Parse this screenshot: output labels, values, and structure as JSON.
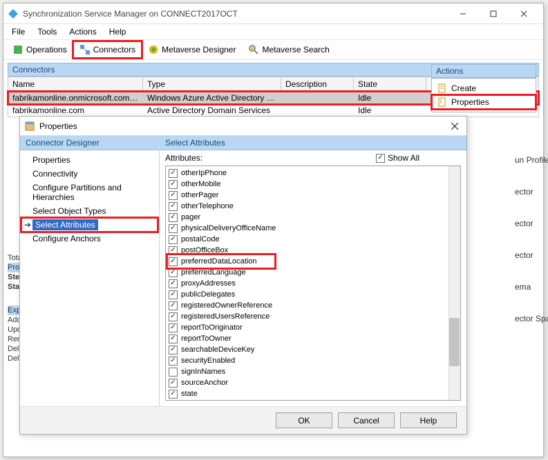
{
  "title": "Synchronization Service Manager on CONNECT2017OCT",
  "menu": [
    "File",
    "Tools",
    "Actions",
    "Help"
  ],
  "toolbar": [
    {
      "label": "Operations",
      "name": "operations-button"
    },
    {
      "label": "Connectors",
      "name": "connectors-button"
    },
    {
      "label": "Metaverse Designer",
      "name": "metaverse-designer-button"
    },
    {
      "label": "Metaverse Search",
      "name": "metaverse-search-button"
    }
  ],
  "connectors_head": "Connectors",
  "grid_cols": {
    "name": "Name",
    "type": "Type",
    "desc": "Description",
    "state": "State"
  },
  "grid_rows": [
    {
      "name": "fabrikamonline.onmicrosoft.com - AAD",
      "type": "Windows Azure Active Directory (Micr...",
      "desc": "",
      "state": "Idle"
    },
    {
      "name": "fabrikamonline.com",
      "type": "Active Directory Domain Services",
      "desc": "",
      "state": "Idle"
    }
  ],
  "actions_head": "Actions",
  "actions": [
    {
      "label": "Create",
      "name": "action-create"
    },
    {
      "label": "Properties",
      "name": "action-properties"
    }
  ],
  "hidden_actions": [
    "un Profiles",
    "ector",
    "ector",
    "ector",
    "ema",
    "ector Space"
  ],
  "bottom_rows1": [
    "Total",
    "Profile"
  ],
  "bottom_rows2": [
    "Step",
    "Star"
  ],
  "bottom_rows3": [
    "Exp",
    "Add",
    "Upd",
    "Ren",
    "Dele",
    "Dele"
  ],
  "dialog": {
    "title": "Properties",
    "left_head": "Connector Designer",
    "left_items": [
      "Properties",
      "Connectivity",
      "Configure Partitions and Hierarchies",
      "Select Object Types",
      "Select Attributes",
      "Configure Anchors"
    ],
    "right_head": "Select Attributes",
    "attr_label": "Attributes:",
    "show_all": "Show All",
    "attributes": [
      {
        "label": "otherIpPhone",
        "checked": true
      },
      {
        "label": "otherMobile",
        "checked": true
      },
      {
        "label": "otherPager",
        "checked": true
      },
      {
        "label": "otherTelephone",
        "checked": true
      },
      {
        "label": "pager",
        "checked": true
      },
      {
        "label": "physicalDeliveryOfficeName",
        "checked": true
      },
      {
        "label": "postalCode",
        "checked": true
      },
      {
        "label": "postOfficeBox",
        "checked": true
      },
      {
        "label": "preferredDataLocation",
        "checked": true
      },
      {
        "label": "preferredLanguage",
        "checked": true
      },
      {
        "label": "proxyAddresses",
        "checked": true
      },
      {
        "label": "publicDelegates",
        "checked": true
      },
      {
        "label": "registeredOwnerReference",
        "checked": true
      },
      {
        "label": "registeredUsersReference",
        "checked": true
      },
      {
        "label": "reportToOriginator",
        "checked": true
      },
      {
        "label": "reportToOwner",
        "checked": true
      },
      {
        "label": "searchableDeviceKey",
        "checked": true
      },
      {
        "label": "securityEnabled",
        "checked": true
      },
      {
        "label": "signInNames",
        "checked": false
      },
      {
        "label": "sourceAnchor",
        "checked": true
      },
      {
        "label": "state",
        "checked": true
      }
    ],
    "buttons": {
      "ok": "OK",
      "cancel": "Cancel",
      "help": "Help"
    }
  }
}
